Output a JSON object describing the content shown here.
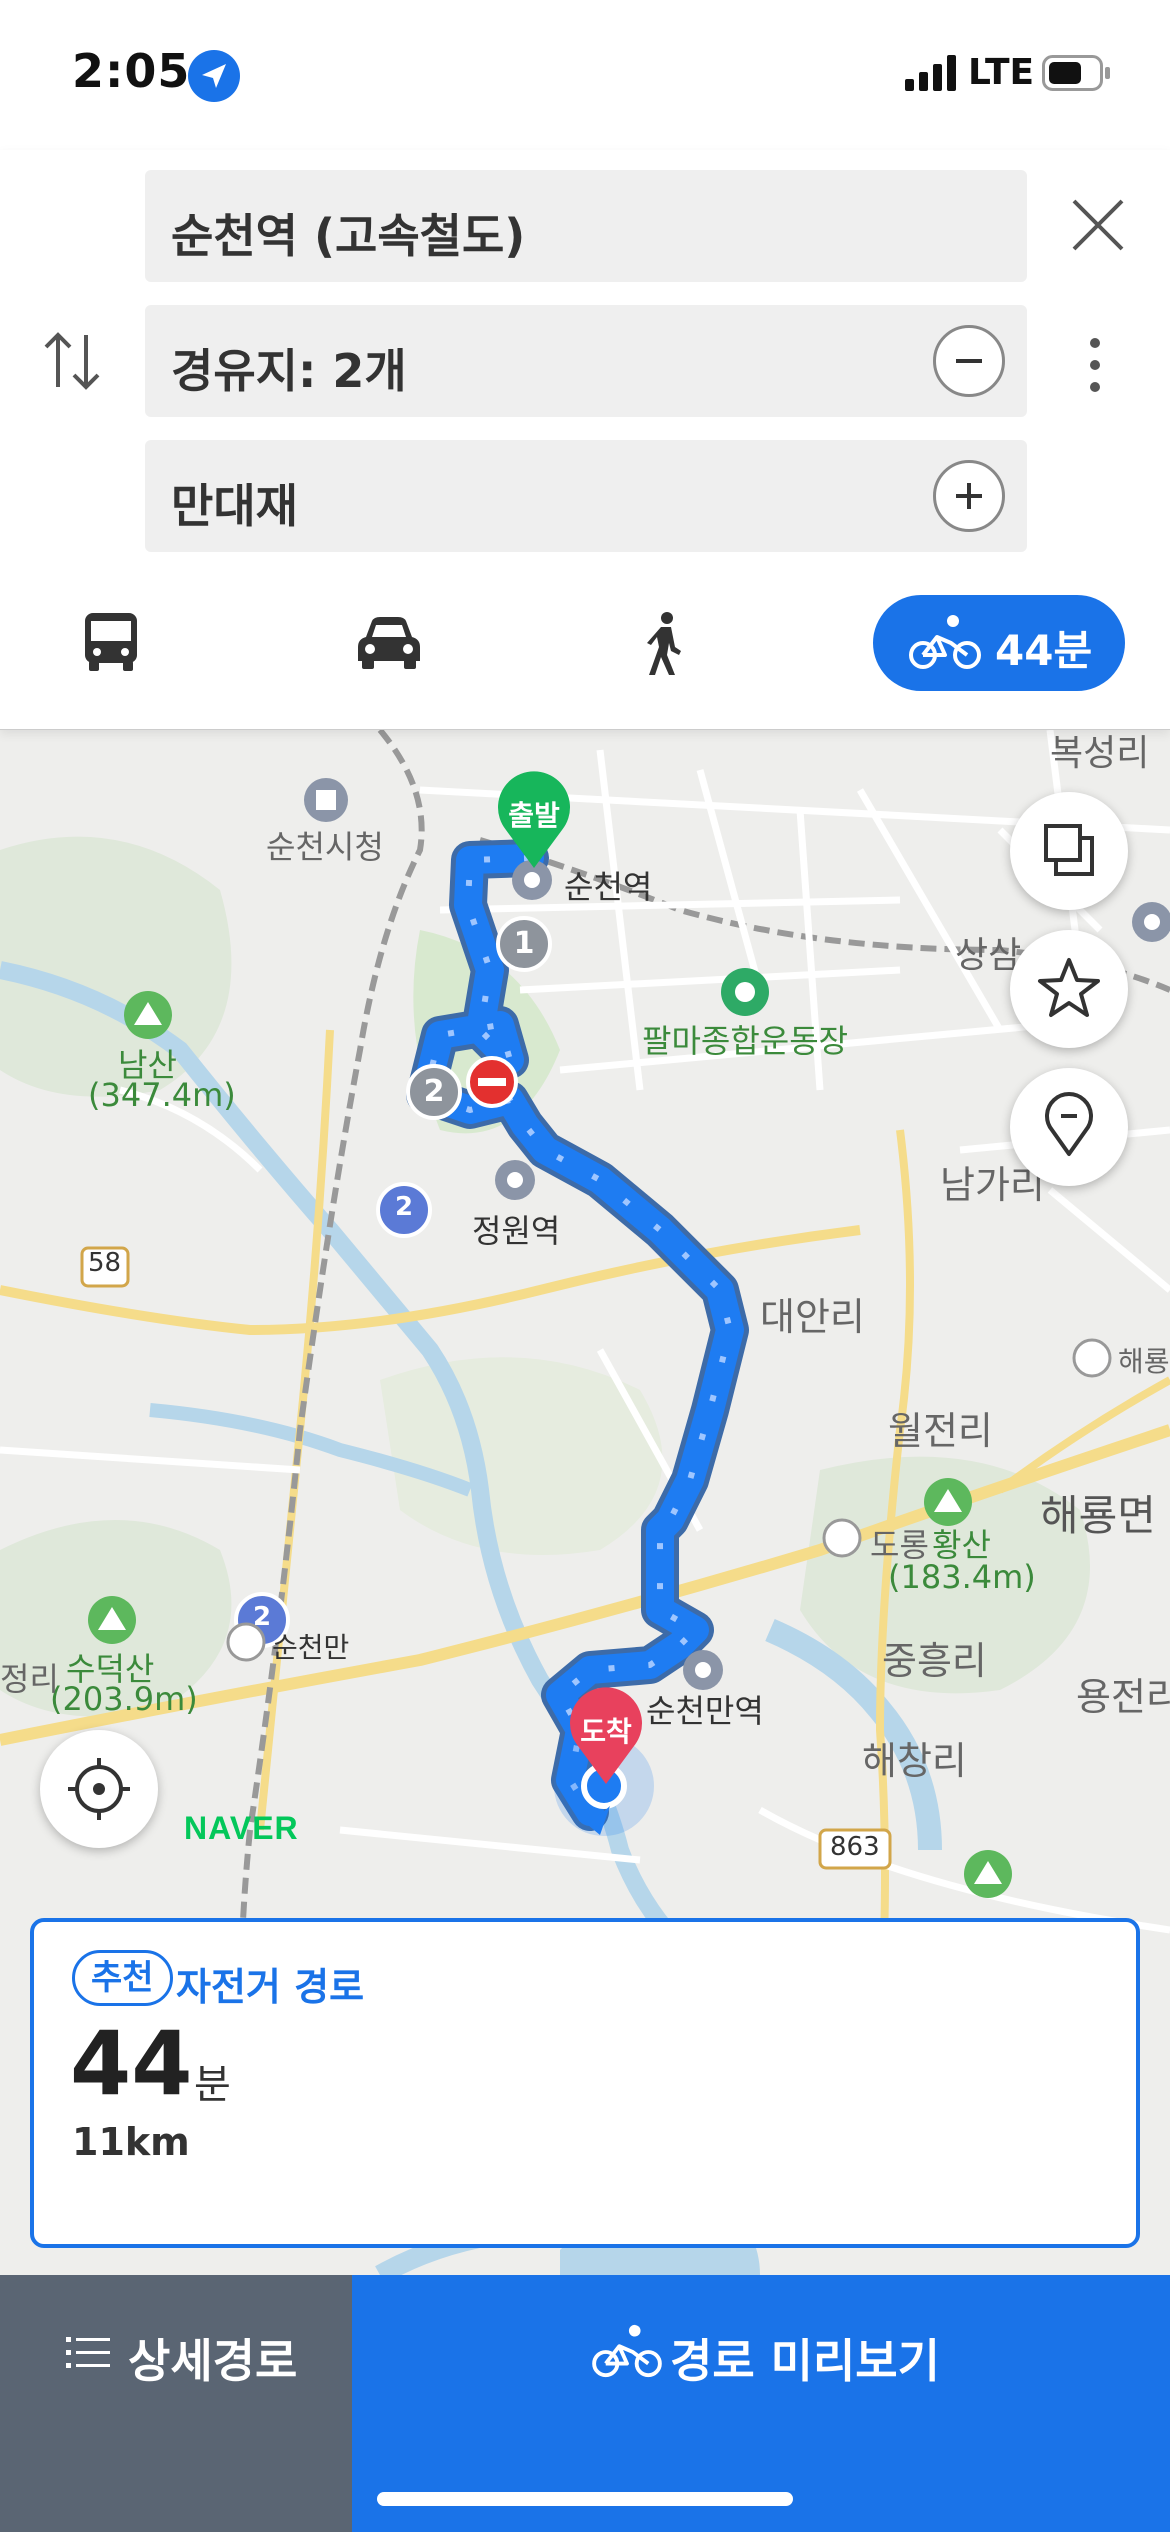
{
  "status_bar": {
    "time": "2:05",
    "carrier": "LTE"
  },
  "route": {
    "origin": "순천역 (고속철도)",
    "waypoints": "경유지: 2개",
    "destination": "만대재"
  },
  "modes": {
    "bike_time": "44분",
    "selected": "bike"
  },
  "map": {
    "labels": {
      "city_hall": "순천시청",
      "station": "순천역",
      "boksung": "복성리",
      "sangsam": "상삼",
      "palma": "팔마종합운동장",
      "namsan": "남산",
      "namsan_height": "(347.4m)",
      "jeongwon": "정원역",
      "namga": "남가리",
      "daean": "대안리",
      "haeryong_ic": "해룡",
      "woljeon": "월전리",
      "haeryong": "해룡면",
      "dorong": "도롱",
      "hwangsan": "황산",
      "hwangsan_height": "(183.4m)",
      "road58": "58",
      "sudeoksan": "수덕산",
      "sudeoksan_height": "(203.9m)",
      "jeong": "정리",
      "suncheonman": "순천만",
      "suncheonman_station": "순천만역",
      "junghung": "중흥리",
      "yongjeon": "용전리",
      "haechang": "해창리",
      "road863": "863",
      "road2a": "2",
      "road2b": "2",
      "naver": "NAVER"
    },
    "start_pin": "출발",
    "end_pin": "도착",
    "waypoint_1": "1",
    "waypoint_2": "2"
  },
  "route_card": {
    "badge": "추천",
    "title": "자전거 경로",
    "duration": "44",
    "duration_unit": "분",
    "distance": "11km"
  },
  "bottom_bar": {
    "detail_label": "상세경로",
    "preview_label": "경로 미리보기"
  },
  "colors": {
    "accent": "#1a73e8",
    "route": "#1e7cf2",
    "start_pin": "#17b65b",
    "end_pin": "#e8415d",
    "detail_bg": "#5a6573"
  }
}
